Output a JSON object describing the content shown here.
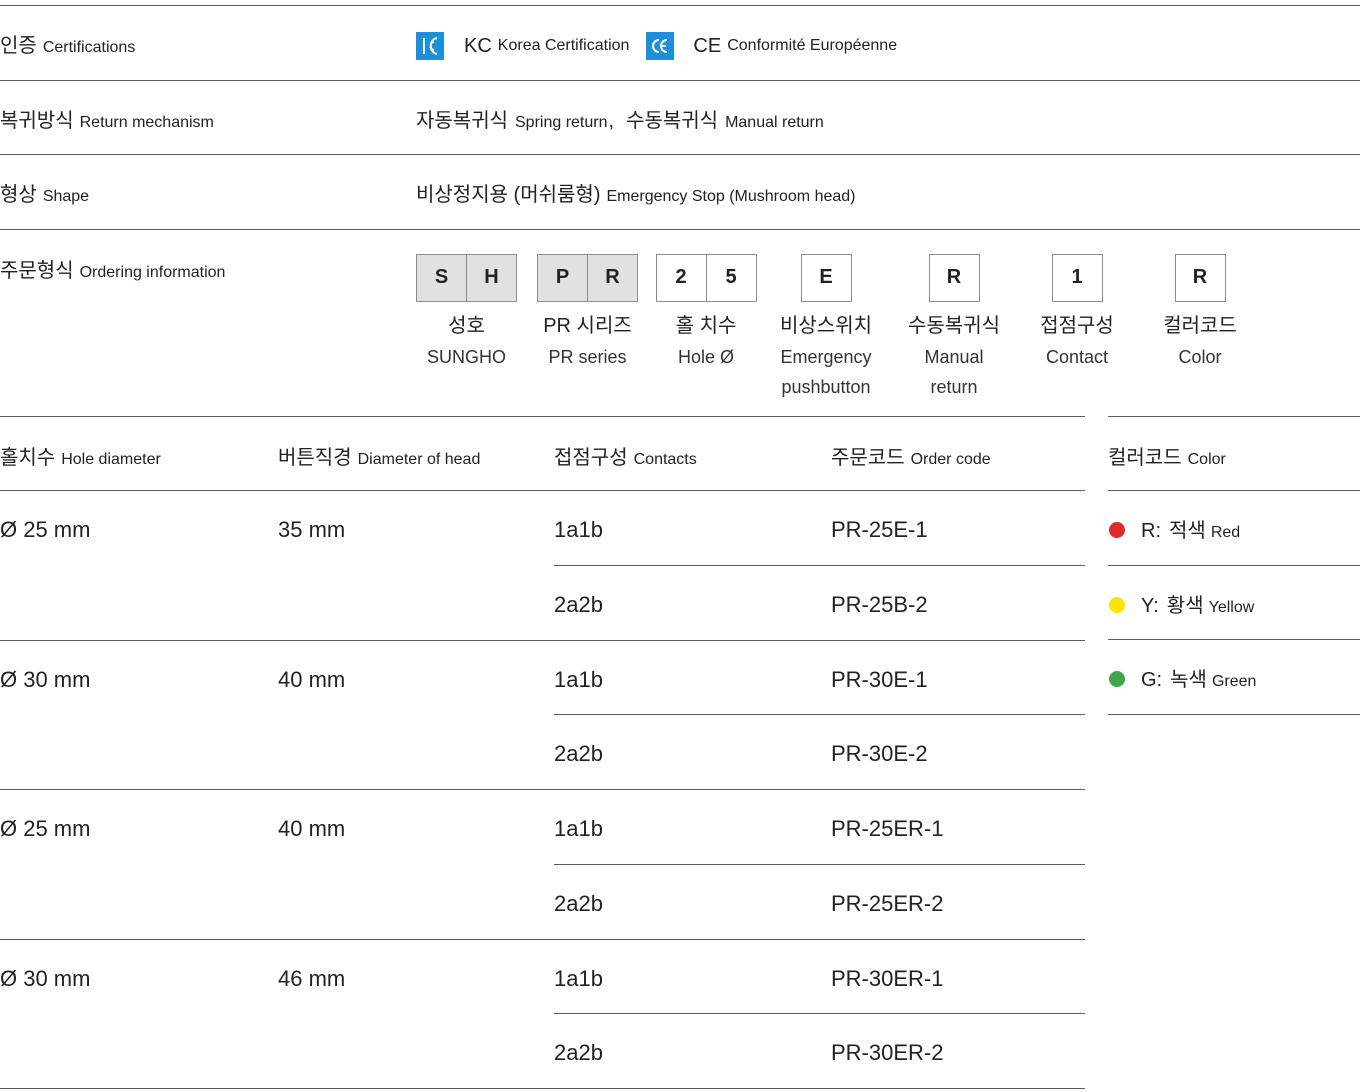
{
  "specs": {
    "certifications": {
      "label_ko": "인증",
      "label_en": "Certifications",
      "items": [
        {
          "icon": "kc-mark-icon",
          "color": "#1b8fd8",
          "code": "KC",
          "name": "Korea Certification"
        },
        {
          "icon": "ce-mark-icon",
          "color": "#1b8fd8",
          "code": "CE",
          "name": "Conformité Européenne"
        }
      ]
    },
    "return_mechanism": {
      "label_ko": "복귀방식",
      "label_en": "Return mechanism",
      "values": [
        {
          "ko": "자동복귀식",
          "en": "Spring return"
        },
        {
          "ko": "수동복귀식",
          "en": "Manual return"
        }
      ],
      "separator": ","
    },
    "shape": {
      "label_ko": "형상",
      "label_en": "Shape",
      "value_ko": "비상정지용 (머쉬룸형)",
      "value_en": "Emergency Stop (Mushroom head)"
    },
    "ordering": {
      "label_ko": "주문형식",
      "label_en": "Ordering information",
      "segments": [
        {
          "chars": [
            "S",
            "H"
          ],
          "label_ko": "성호",
          "label_en": [
            "SUNGHO"
          ]
        },
        {
          "chars": [
            "P",
            "R"
          ],
          "label_ko": "PR 시리즈",
          "label_en": [
            "PR series"
          ]
        },
        {
          "chars": [
            "2",
            "5"
          ],
          "label_ko": "홀 치수",
          "label_en": [
            "Hole Ø"
          ]
        },
        {
          "chars": [
            "E"
          ],
          "label_ko": "비상스위치",
          "label_en": [
            "Emergency",
            "pushbutton"
          ]
        },
        {
          "chars": [
            "R"
          ],
          "label_ko": "수동복귀식",
          "label_en": [
            "Manual",
            "return"
          ]
        },
        {
          "chars": [
            "1"
          ],
          "label_ko": "접점구성",
          "label_en": [
            "Contact"
          ]
        },
        {
          "chars": [
            "R"
          ],
          "label_ko": "컬러코드",
          "label_en": [
            "Color"
          ]
        }
      ]
    }
  },
  "product_table": {
    "headers": [
      {
        "ko": "홀치수",
        "en": "Hole diameter"
      },
      {
        "ko": "버튼직경",
        "en": "Diameter of head"
      },
      {
        "ko": "접점구성",
        "en": "Contacts"
      },
      {
        "ko": "주문코드",
        "en": "Order code"
      }
    ],
    "rows": [
      {
        "hole": "Ø 25 mm",
        "head": "35 mm",
        "variants": [
          {
            "contacts": "1a1b",
            "code": "PR-25E-1"
          },
          {
            "contacts": "2a2b",
            "code": "PR-25B-2"
          }
        ]
      },
      {
        "hole": "Ø 30 mm",
        "head": "40 mm",
        "variants": [
          {
            "contacts": "1a1b",
            "code": "PR-30E-1"
          },
          {
            "contacts": "2a2b",
            "code": "PR-30E-2"
          }
        ]
      },
      {
        "hole": "Ø 25 mm",
        "head": "40 mm",
        "variants": [
          {
            "contacts": "1a1b",
            "code": "PR-25ER-1"
          },
          {
            "contacts": "2a2b",
            "code": "PR-25ER-2"
          }
        ]
      },
      {
        "hole": "Ø 30 mm",
        "head": "46 mm",
        "variants": [
          {
            "contacts": "1a1b",
            "code": "PR-30ER-1"
          },
          {
            "contacts": "2a2b",
            "code": "PR-30ER-2"
          }
        ]
      }
    ]
  },
  "color_table": {
    "header": {
      "ko": "컬러코드",
      "en": "Color"
    },
    "items": [
      {
        "code": "R:",
        "ko": "적색",
        "en": "Red",
        "color": "#dd2a2e"
      },
      {
        "code": "Y:",
        "ko": "황색",
        "en": "Yellow",
        "color": "#fbe400"
      },
      {
        "code": "G:",
        "ko": "녹색",
        "en": "Green",
        "color": "#3fa649"
      }
    ]
  }
}
